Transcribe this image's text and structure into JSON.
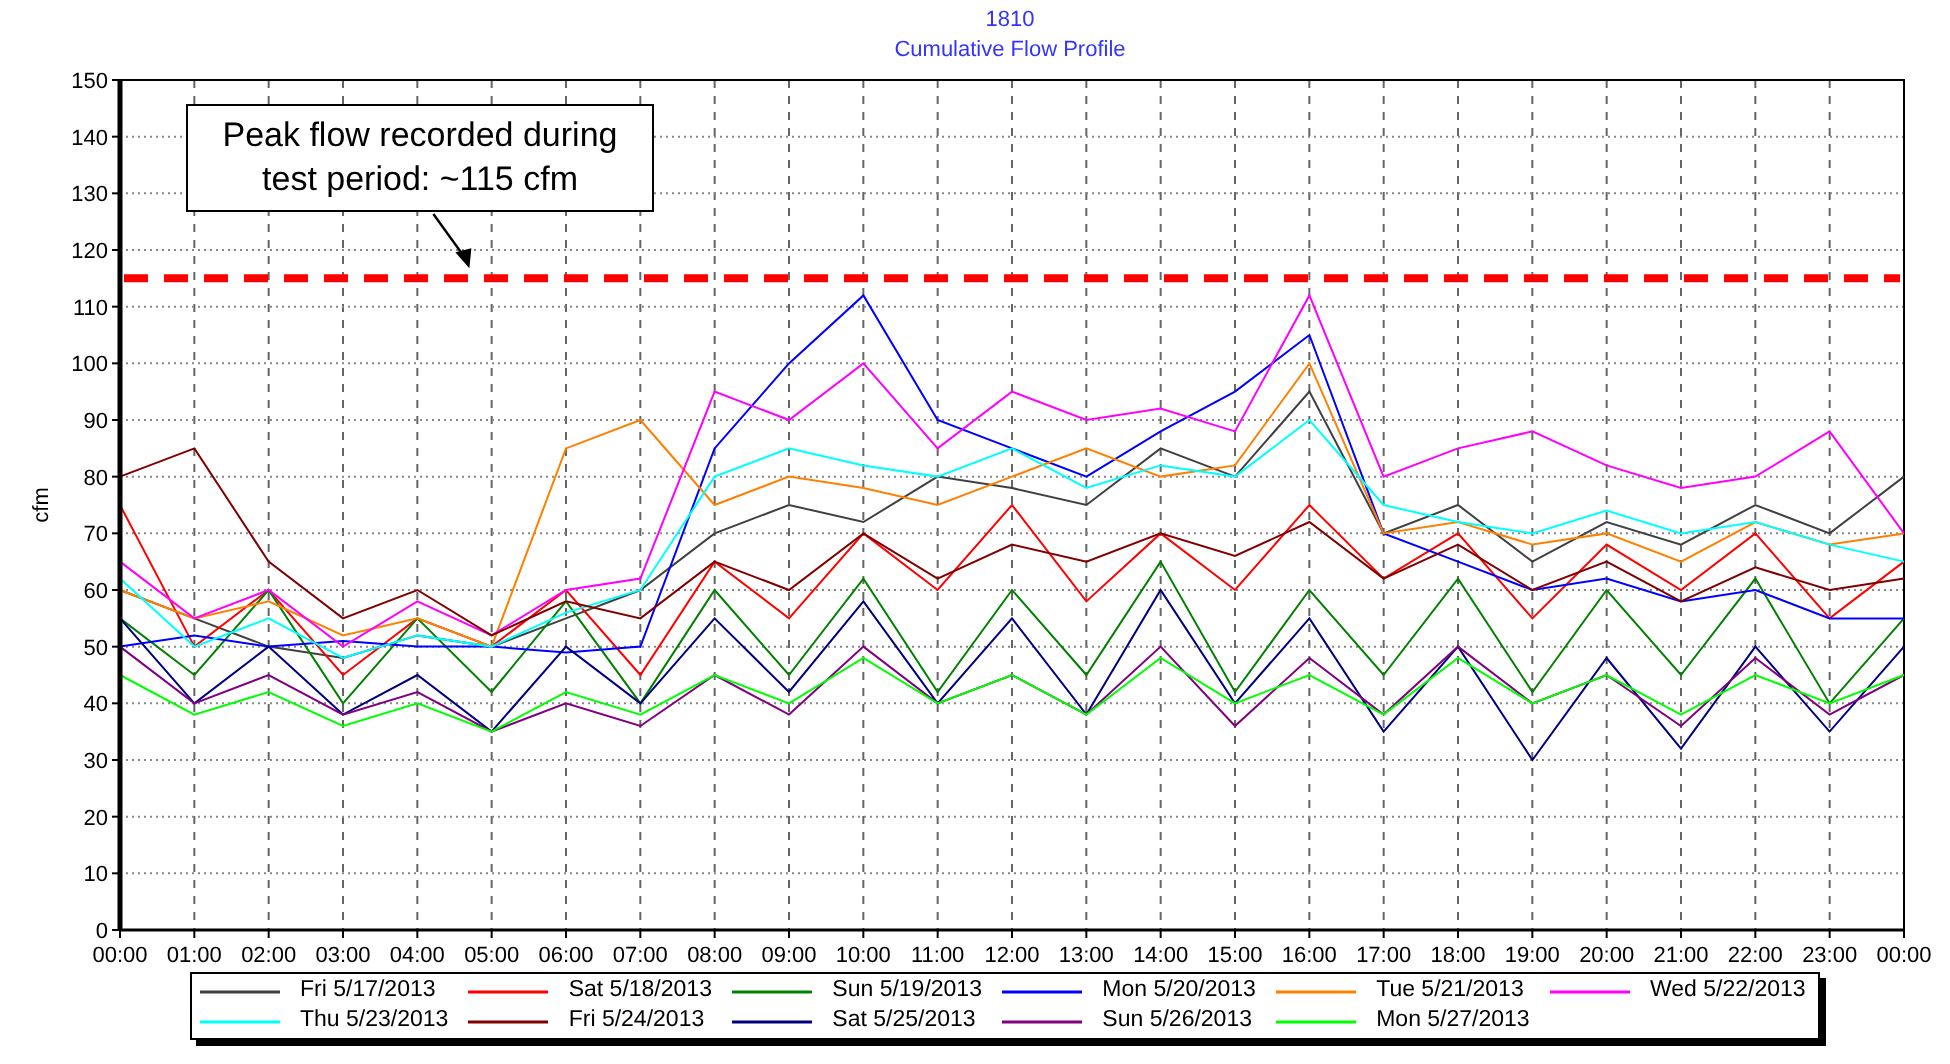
{
  "header": {
    "title": "1810",
    "subtitle": "Cumulative Flow Profile"
  },
  "chart_data": {
    "type": "line",
    "ylabel": "cfm",
    "xlim": [
      0,
      24
    ],
    "ylim": [
      0,
      150
    ],
    "x": [
      0,
      1,
      2,
      3,
      4,
      5,
      6,
      7,
      8,
      9,
      10,
      11,
      12,
      13,
      14,
      15,
      16,
      17,
      18,
      19,
      20,
      21,
      22,
      23,
      24
    ],
    "xticks": [
      {
        "value": 0,
        "label": "00:00"
      },
      {
        "value": 1,
        "label": "01:00"
      },
      {
        "value": 2,
        "label": "02:00"
      },
      {
        "value": 3,
        "label": "03:00"
      },
      {
        "value": 4,
        "label": "04:00"
      },
      {
        "value": 5,
        "label": "05:00"
      },
      {
        "value": 6,
        "label": "06:00"
      },
      {
        "value": 7,
        "label": "07:00"
      },
      {
        "value": 8,
        "label": "08:00"
      },
      {
        "value": 9,
        "label": "09:00"
      },
      {
        "value": 10,
        "label": "10:00"
      },
      {
        "value": 11,
        "label": "11:00"
      },
      {
        "value": 12,
        "label": "12:00"
      },
      {
        "value": 13,
        "label": "13:00"
      },
      {
        "value": 14,
        "label": "14:00"
      },
      {
        "value": 15,
        "label": "15:00"
      },
      {
        "value": 16,
        "label": "16:00"
      },
      {
        "value": 17,
        "label": "17:00"
      },
      {
        "value": 18,
        "label": "18:00"
      },
      {
        "value": 19,
        "label": "19:00"
      },
      {
        "value": 20,
        "label": "20:00"
      },
      {
        "value": 21,
        "label": "21:00"
      },
      {
        "value": 22,
        "label": "22:00"
      },
      {
        "value": 23,
        "label": "23:00"
      },
      {
        "value": 24,
        "label": "00:00"
      }
    ],
    "yticks": [
      0,
      10,
      20,
      30,
      40,
      50,
      60,
      70,
      80,
      90,
      100,
      110,
      120,
      130,
      140,
      150
    ],
    "series": [
      {
        "name": "Fri 5/17/2013",
        "color": "#404040",
        "values": [
          60,
          55,
          50,
          48,
          52,
          50,
          55,
          60,
          70,
          75,
          72,
          80,
          78,
          75,
          85,
          80,
          95,
          70,
          75,
          65,
          72,
          68,
          75,
          70,
          80
        ]
      },
      {
        "name": "Sat 5/18/2013",
        "color": "#ff0000",
        "values": [
          75,
          50,
          60,
          45,
          55,
          50,
          60,
          45,
          65,
          55,
          70,
          60,
          75,
          58,
          70,
          60,
          75,
          62,
          70,
          55,
          68,
          60,
          70,
          55,
          65
        ]
      },
      {
        "name": "Sun 5/19/2013",
        "color": "#008000",
        "values": [
          55,
          45,
          60,
          40,
          55,
          42,
          58,
          40,
          60,
          45,
          62,
          42,
          60,
          45,
          65,
          42,
          60,
          45,
          62,
          42,
          60,
          45,
          62,
          40,
          55
        ]
      },
      {
        "name": "Mon 5/20/2013",
        "color": "#0000ff",
        "values": [
          50,
          52,
          50,
          51,
          50,
          50,
          49,
          50,
          85,
          100,
          112,
          90,
          85,
          80,
          88,
          95,
          105,
          70,
          65,
          60,
          62,
          58,
          60,
          55,
          55
        ]
      },
      {
        "name": "Tue 5/21/2013",
        "color": "#ff8000",
        "values": [
          60,
          55,
          58,
          52,
          55,
          50,
          85,
          90,
          75,
          80,
          78,
          75,
          80,
          85,
          80,
          82,
          100,
          70,
          72,
          68,
          70,
          65,
          72,
          68,
          70
        ]
      },
      {
        "name": "Wed 5/22/2013",
        "color": "#ff00ff",
        "values": [
          65,
          55,
          60,
          50,
          58,
          52,
          60,
          62,
          95,
          90,
          100,
          85,
          95,
          90,
          92,
          88,
          112,
          80,
          85,
          88,
          82,
          78,
          80,
          88,
          70
        ]
      },
      {
        "name": "Thu 5/23/2013",
        "color": "#00ffff",
        "values": [
          62,
          50,
          55,
          48,
          52,
          50,
          56,
          60,
          80,
          85,
          82,
          80,
          85,
          78,
          82,
          80,
          90,
          75,
          72,
          70,
          74,
          70,
          72,
          68,
          65
        ]
      },
      {
        "name": "Fri 5/24/2013",
        "color": "#800000",
        "values": [
          80,
          85,
          65,
          55,
          60,
          52,
          58,
          55,
          65,
          60,
          70,
          62,
          68,
          65,
          70,
          66,
          72,
          62,
          68,
          60,
          65,
          58,
          64,
          60,
          62
        ]
      },
      {
        "name": "Sat 5/25/2013",
        "color": "#000080",
        "values": [
          55,
          40,
          50,
          38,
          45,
          35,
          50,
          40,
          55,
          42,
          58,
          40,
          55,
          38,
          60,
          40,
          55,
          35,
          50,
          30,
          48,
          32,
          50,
          35,
          50
        ]
      },
      {
        "name": "Sun 5/26/2013",
        "color": "#800080",
        "values": [
          50,
          40,
          45,
          38,
          42,
          35,
          40,
          36,
          45,
          38,
          50,
          40,
          45,
          38,
          50,
          36,
          48,
          38,
          50,
          40,
          45,
          36,
          48,
          38,
          45
        ]
      },
      {
        "name": "Mon 5/27/2013",
        "color": "#00ff00",
        "values": [
          45,
          38,
          42,
          36,
          40,
          35,
          42,
          38,
          45,
          40,
          48,
          40,
          45,
          38,
          48,
          40,
          45,
          38,
          48,
          40,
          45,
          38,
          45,
          40,
          45
        ]
      }
    ],
    "grid": true,
    "ref_lines": [
      {
        "axis": "y",
        "value": 115,
        "color": "#ff0000"
      }
    ],
    "annotations": [
      "Peak flow recorded during test period: ~115 cfm"
    ]
  }
}
